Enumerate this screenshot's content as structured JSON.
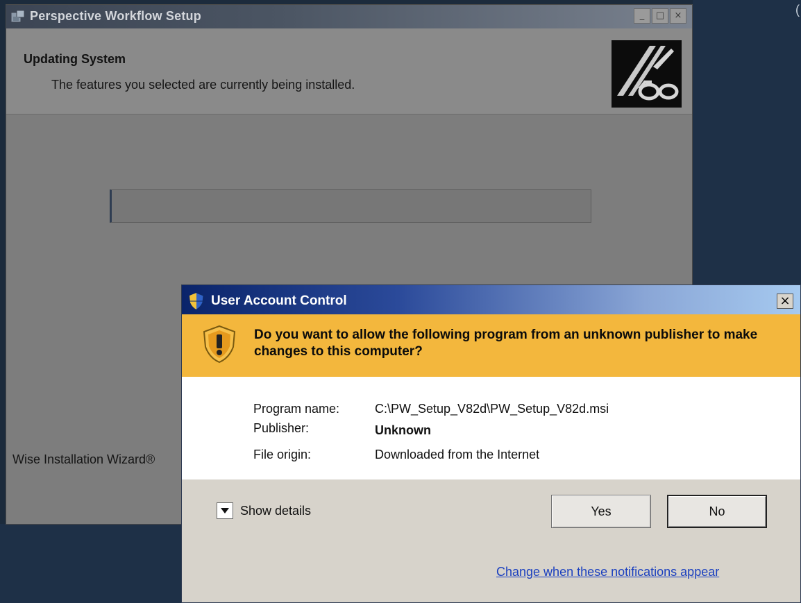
{
  "setup_window": {
    "title": "Perspective Workflow Setup",
    "heading": "Updating System",
    "subheading": "The features you selected are currently being installed.",
    "footer_label": "Wise Installation Wizard®",
    "progress": 0
  },
  "uac_dialog": {
    "title": "User Account Control",
    "question": "Do you want to allow the following program from an unknown publisher to make changes to this computer?",
    "fields": [
      {
        "label": "Program name:",
        "value": "C:\\PW_Setup_V82d\\PW_Setup_V82d.msi"
      },
      {
        "label": "Publisher:",
        "value": "Unknown"
      },
      {
        "label": "File origin:",
        "value": "Downloaded from the Internet"
      }
    ],
    "show_details_label": "Show details",
    "yes_label": "Yes",
    "no_label": "No",
    "notifications_link": "Change when these notifications appear",
    "close_glyph": "×"
  },
  "titlebar_buttons": {
    "minimize": "_",
    "maximize": "□",
    "close": "×"
  },
  "icons": [
    "installer-icon",
    "setup-logo-icon",
    "uac-shield-icon",
    "warning-shield-icon",
    "chevron-down-icon"
  ],
  "colors": {
    "uac_banner": "#f3b73d",
    "link": "#1a3fbf",
    "uac_titlebar_start": "#0a246a"
  }
}
